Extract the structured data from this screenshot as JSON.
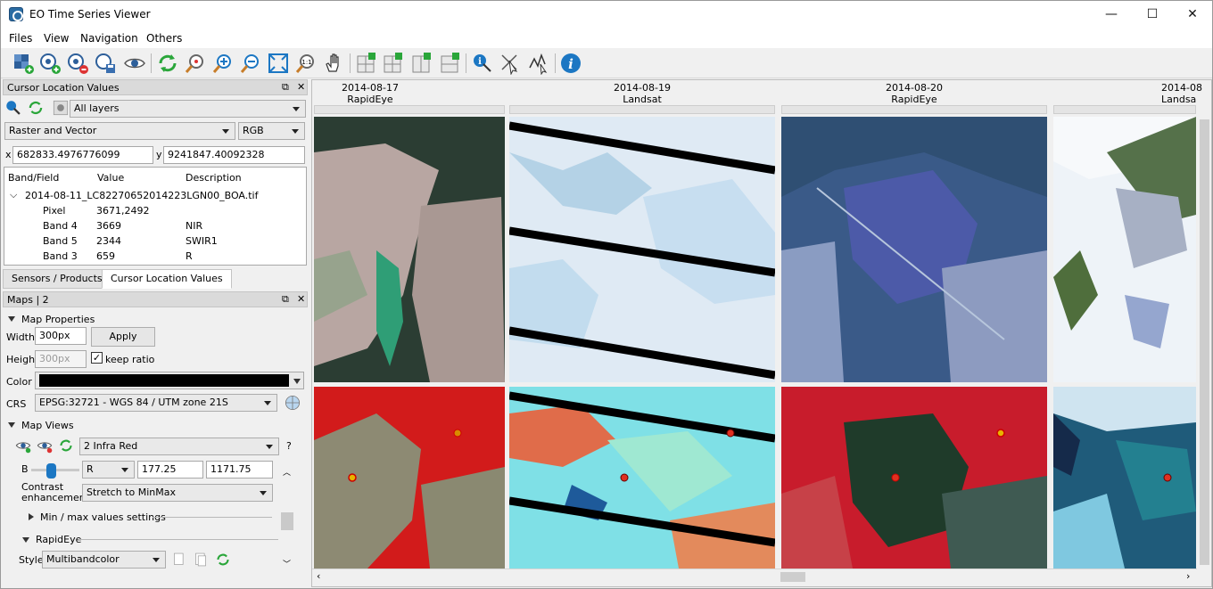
{
  "window": {
    "title": "EO Time Series Viewer",
    "minimize": "—",
    "maximize": "☐",
    "close": "✕"
  },
  "menu": {
    "items": [
      "Files",
      "View",
      "Navigation",
      "Others"
    ]
  },
  "toolbar": {
    "icons": [
      "add-raster-icon",
      "add-vector-icon",
      "remove-icon",
      "save-icon",
      "eye-icon",
      "refresh-icon",
      "zoom-pixel-icon",
      "zoom-in-icon",
      "zoom-out-icon",
      "zoom-full-icon",
      "zoom-actual-icon",
      "pan-icon",
      "sync-map-1-icon",
      "sync-map-2-icon",
      "sync-map-3-icon",
      "sync-map-4-icon",
      "identify-icon",
      "select-icon",
      "spectral-profile-icon",
      "info-icon"
    ]
  },
  "cursor_panel": {
    "title": "Cursor Location Values",
    "layers_combo": "All layers",
    "mode_combo": "Raster and Vector",
    "crs_combo": "RGB",
    "x_label": "x",
    "x_value": "682833.4976776099",
    "y_label": "y",
    "y_value": "9241847.40092328",
    "columns": [
      "Band/Field",
      "Value",
      "Description"
    ],
    "file": "2014-08-11_LC82270652014223LGN00_BOA.tif",
    "rows": [
      {
        "field": "Pixel",
        "value": "3671,2492",
        "desc": ""
      },
      {
        "field": "Band 4",
        "value": "3669",
        "desc": "NIR"
      },
      {
        "field": "Band 5",
        "value": "2344",
        "desc": "SWIR1"
      },
      {
        "field": "Band 3",
        "value": "659",
        "desc": "R"
      }
    ],
    "tabs": [
      "Sensors / Products",
      "Cursor Location Values"
    ]
  },
  "maps_panel": {
    "title": "Maps | 2",
    "properties_label": "Map Properties",
    "width_label": "Width",
    "width_value": "300px",
    "apply": "Apply",
    "height_label": "Height",
    "height_value": "300px",
    "keep_ratio": "keep ratio",
    "keep_ratio_checked": true,
    "color_label": "Color",
    "color_value": "#000000",
    "crs_label": "CRS",
    "crs_value": "EPSG:32721 - WGS 84 / UTM zone 21S",
    "views_label": "Map Views",
    "view_combo": "2 Infra Red",
    "help": "?",
    "band_label": "B",
    "band_combo": "R",
    "min_value": "177.25",
    "max_value": "1171.75",
    "contrast_label": "Contrast enhancement",
    "contrast_combo": "Stretch to MinMax",
    "minmax_label": "Min / max values settings",
    "sensor_label": "RapidEye",
    "style_label": "Style",
    "style_combo": "Multibandcolor"
  },
  "timeline": {
    "columns": [
      {
        "date": "2014-08-17",
        "sensor": "RapidEye"
      },
      {
        "date": "2014-08-19",
        "sensor": "Landsat"
      },
      {
        "date": "2014-08-20",
        "sensor": "RapidEye"
      },
      {
        "date": "2014-08",
        "sensor": "Landsa"
      }
    ]
  },
  "colors": {
    "accent": "#1c77c3",
    "refresh": "#2aa63a",
    "marker": "#e03020"
  }
}
